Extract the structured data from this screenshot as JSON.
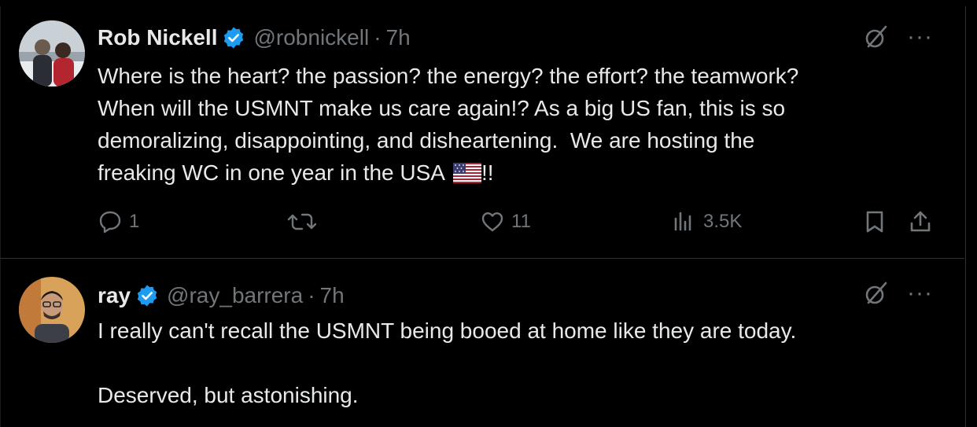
{
  "posts": [
    {
      "author_name": "Rob Nickell",
      "handle": "@robnickell",
      "separator": "·",
      "time": "7h",
      "text_lines": [
        "Where is the heart? the passion? the energy? the effort? the teamwork?",
        "When will the USMNT make us care again!? As a big US fan, this is so",
        "demoralizing, disappointing, and disheartening.  We are hosting the",
        "freaking WC in one year in the USA"
      ],
      "text_tail": "!!",
      "flag_emoji": "us-flag-icon",
      "replies": "1",
      "retweets": "",
      "likes": "11",
      "views": "3.5K"
    },
    {
      "author_name": "ray",
      "handle": "@ray_barrera",
      "separator": "·",
      "time": "7h",
      "text_lines": [
        "I really can't recall the USMNT being booed at home like they are today.",
        "",
        "Deserved, but astonishing."
      ]
    }
  ],
  "icons": {
    "verified": "verified-badge-icon",
    "grok": "grok-icon",
    "more": "more-icon",
    "reply": "reply-icon",
    "retweet": "retweet-icon",
    "like": "heart-icon",
    "views": "views-icon",
    "bookmark": "bookmark-icon",
    "share": "share-icon"
  },
  "colors": {
    "background": "#000000",
    "text": "#e7e9ea",
    "muted": "#71767b",
    "verified": "#1d9bf0",
    "divider": "#2f3336"
  },
  "more_label": "···"
}
